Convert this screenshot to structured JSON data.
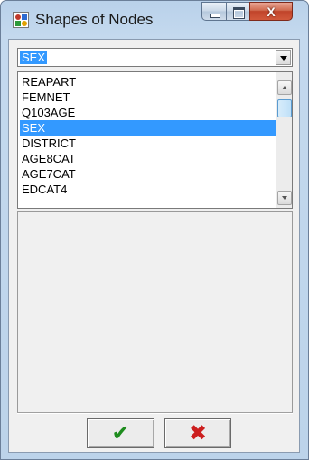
{
  "window": {
    "title": "Shapes of Nodes",
    "close_symbol": "X"
  },
  "combo": {
    "selected_value": "SEX"
  },
  "list": {
    "items": [
      "REAPART",
      "FEMNET",
      "Q103AGE",
      "SEX",
      "DISTRICT",
      "AGE8CAT",
      "AGE7CAT",
      "EDCAT4"
    ],
    "selected": "SEX"
  },
  "buttons": {
    "ok_symbol": "✔",
    "cancel_symbol": "✖"
  },
  "colors": {
    "selection": "#3399ff",
    "ok": "#1e8c1e",
    "cancel": "#cc1f1f"
  },
  "icons": {
    "app": "node-shapes-icon",
    "minimize": "minimize-icon",
    "maximize": "maximize-icon",
    "close": "close-icon",
    "ok": "checkmark-icon",
    "cancel": "x-mark-icon"
  }
}
